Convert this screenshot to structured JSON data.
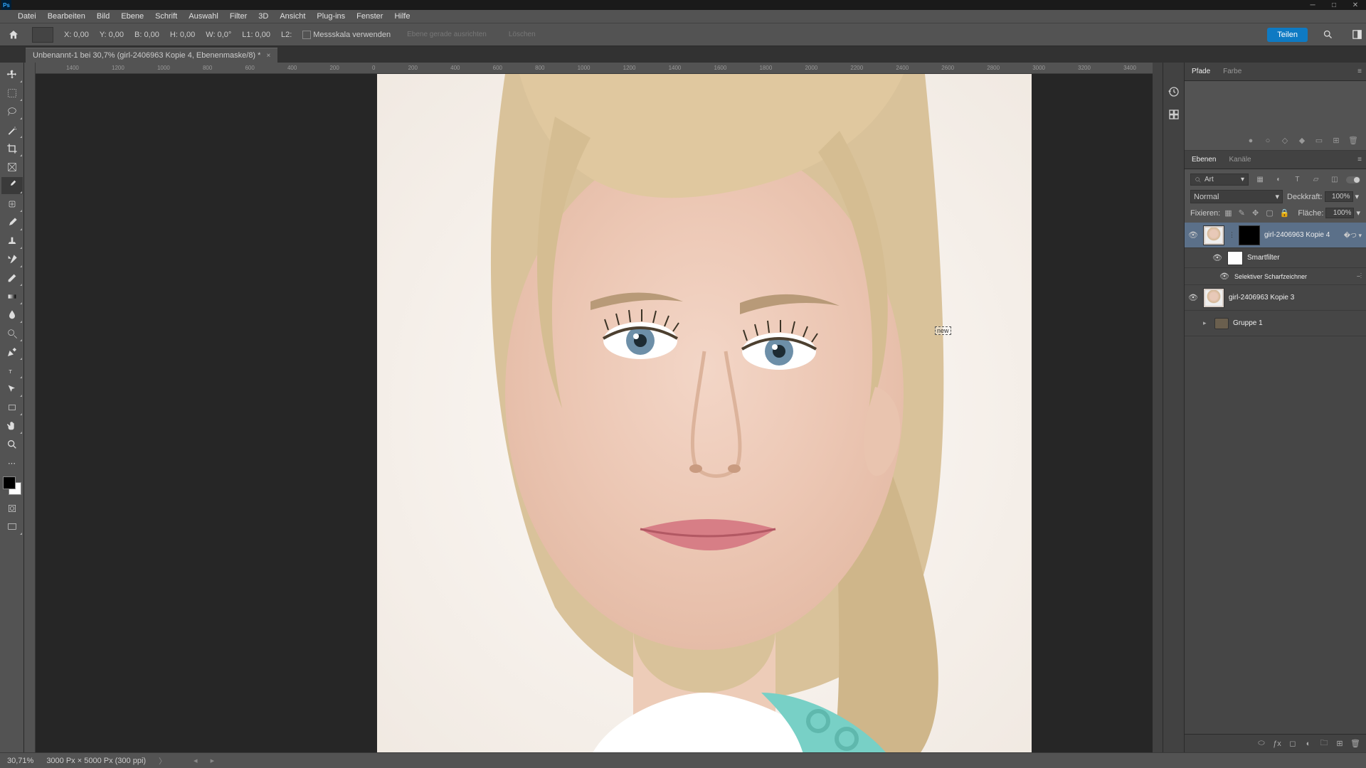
{
  "titlebar": {
    "app_initials": "Ps"
  },
  "menu": {
    "items": [
      "Datei",
      "Bearbeiten",
      "Bild",
      "Ebene",
      "Schrift",
      "Auswahl",
      "Filter",
      "3D",
      "Ansicht",
      "Plug-ins",
      "Fenster",
      "Hilfe"
    ]
  },
  "options": {
    "x_label": "X:",
    "x_value": "0,00",
    "y_label": "Y:",
    "y_value": "0,00",
    "b_label": "B:",
    "b_value": "0,00",
    "h_label": "H:",
    "h_value": "0,00",
    "w_label": "W:",
    "w_value": "0,0°",
    "l1_label": "L1:",
    "l1_value": "0,00",
    "l2_label": "L2:",
    "measure_scale": "Messskala verwenden",
    "straighten": "Ebene gerade ausrichten",
    "clear": "Löschen",
    "share": "Teilen"
  },
  "document": {
    "tab_title": "Unbenannt-1 bei 30,7% (girl-2406963 Kopie 4, Ebenenmaske/8) *"
  },
  "ruler_ticks": [
    "1400",
    "1200",
    "1000",
    "800",
    "600",
    "400",
    "200",
    "0",
    "200",
    "400",
    "600",
    "800",
    "1000",
    "1200",
    "1400",
    "1600",
    "1800",
    "2000",
    "2200",
    "2400",
    "2600",
    "2800",
    "3000",
    "3200",
    "3400"
  ],
  "canvas_cursor_label": "new",
  "panels": {
    "pfade_tab": "Pfade",
    "farbe_tab": "Farbe",
    "ebenen_tab": "Ebenen",
    "kanaele_tab": "Kanäle"
  },
  "layers": {
    "search_kind_label": "Art",
    "blend_mode": "Normal",
    "opacity_label": "Deckkraft:",
    "opacity_value": "100%",
    "lock_label": "Fixieren:",
    "fill_label": "Fläche:",
    "fill_value": "100%",
    "items": [
      {
        "name": "girl-2406963 Kopie 4",
        "selected": true,
        "has_mask": true
      },
      {
        "name": "Smartfilter",
        "sub": true
      },
      {
        "name": "Selektiver Scharfzeichner",
        "sub2": true
      },
      {
        "name": "girl-2406963 Kopie 3"
      },
      {
        "name": "Gruppe 1",
        "folder": true
      }
    ]
  },
  "status": {
    "zoom": "30,71%",
    "doc_info": "3000 Px × 5000 Px (300 ppi)"
  },
  "colors": {
    "accent": "#0e7ac3",
    "panel": "#535353",
    "dark": "#323232"
  }
}
